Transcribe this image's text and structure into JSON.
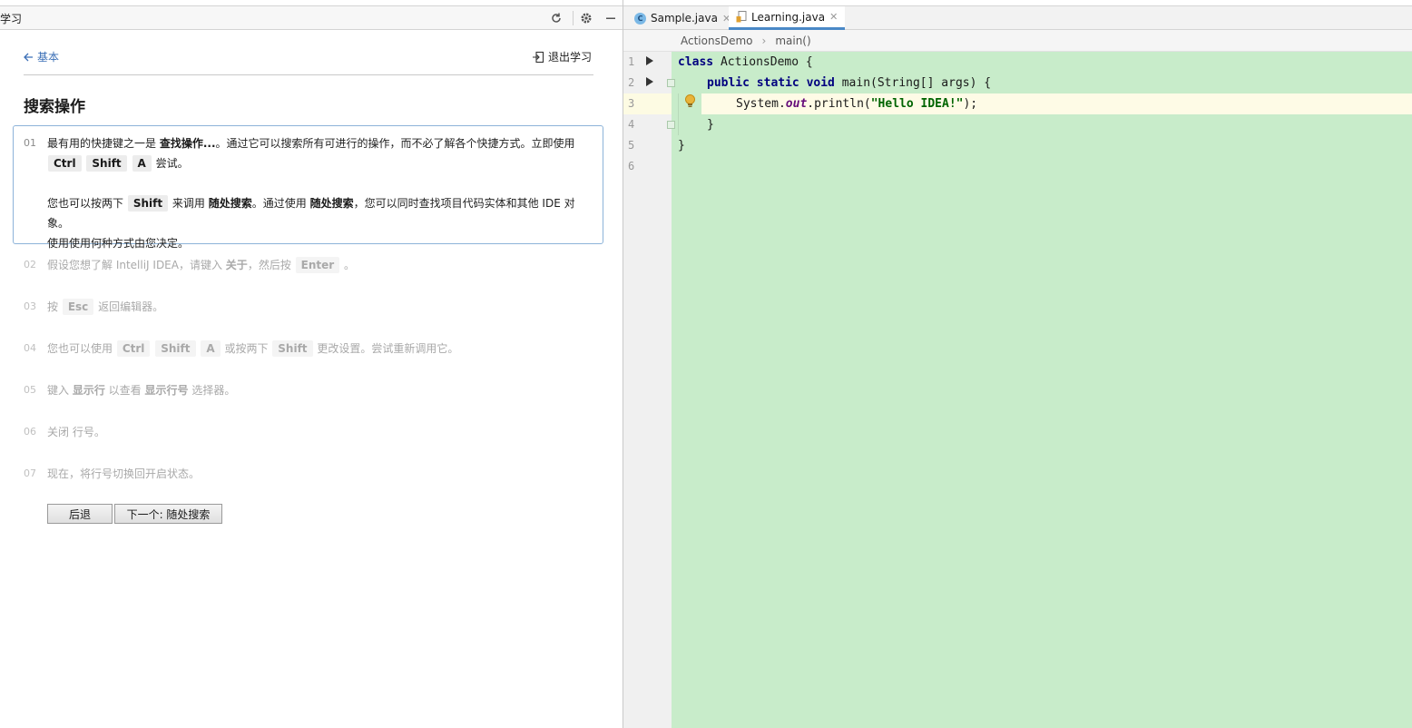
{
  "panel": {
    "title": "学习",
    "back_label": "基本",
    "exit_label": "退出学习",
    "lesson_title": "搜索操作"
  },
  "steps": [
    {
      "num": "01",
      "p1_a": "最有用的快捷键之一是 ",
      "p1_b": "查找操作...",
      "p1_c": "。通过它可以搜索所有可进行的操作，而不必了解各个快捷方式。立即使用",
      "keys1": [
        "Ctrl",
        "Shift",
        "A"
      ],
      "p1_d": " 尝试。",
      "p2_a": "您也可以按两下 ",
      "p2_key": "Shift",
      "p2_b": " 来调用 ",
      "p2_c": "随处搜索",
      "p2_d": "。通过使用 ",
      "p2_e": "随处搜索",
      "p2_f": "，您可以同时查找项目代码实体和其他 IDE 对象。",
      "p3": "使用使用何种方式由您决定。"
    },
    {
      "num": "02",
      "a": "假设您想了解 IntelliJ IDEA，请键入 ",
      "b": "关于",
      "c": "，然后按 ",
      "key": "Enter",
      "d": " 。"
    },
    {
      "num": "03",
      "a": "按 ",
      "key": "Esc",
      "b": " 返回编辑器。"
    },
    {
      "num": "04",
      "a": "您也可以使用 ",
      "keys": [
        "Ctrl",
        "Shift",
        "A"
      ],
      "b": " 或按两下 ",
      "key2": "Shift",
      "c": " 更改设置。尝试重新调用它。"
    },
    {
      "num": "05",
      "a": "键入 ",
      "b": "显示行",
      "c": " 以查看 ",
      "d": "显示行号",
      "e": " 选择器。"
    },
    {
      "num": "06",
      "a": "关闭 行号。"
    },
    {
      "num": "07",
      "a": "现在，将行号切换回开启状态。"
    }
  ],
  "buttons": {
    "back": "后退",
    "next": "下一个: 随处搜索"
  },
  "editor": {
    "tabs": [
      {
        "label": "Sample.java",
        "icon": "class-icon",
        "active": false
      },
      {
        "label": "Learning.java",
        "icon": "java-file-icon",
        "active": true
      }
    ],
    "breadcrumb": [
      "ActionsDemo",
      "main()"
    ],
    "line_numbers": [
      "1",
      "2",
      "3",
      "4",
      "5",
      "6"
    ],
    "code": {
      "l1_kw": "class",
      "l1_rest": " ActionsDemo {",
      "l2_kw": "public static void",
      "l2_rest": " main(String[] args) {",
      "l3_a": "System.",
      "l3_field": "out",
      "l3_b": ".println(",
      "l3_str": "\"Hello IDEA!\"",
      "l3_c": ");",
      "l4": "}",
      "l5": "}"
    },
    "colors": {
      "background": "#c8ecca",
      "caret_line": "#fefbe6",
      "accent": "#4a88c7"
    }
  }
}
